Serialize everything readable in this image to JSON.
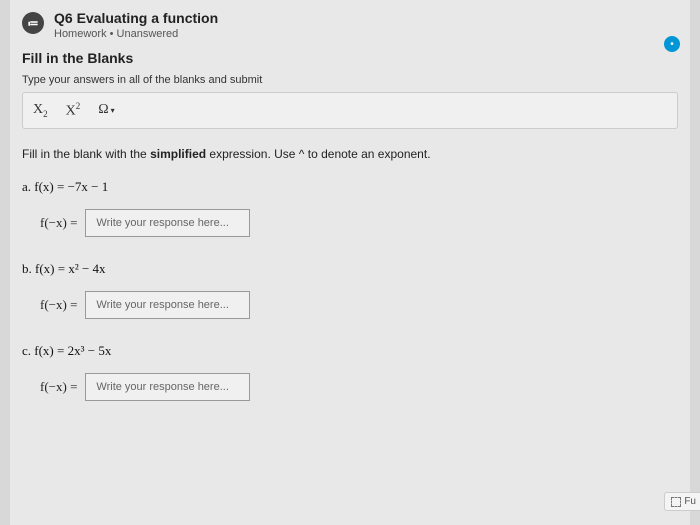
{
  "header": {
    "icon_glyph": "≔",
    "title": "Q6 Evaluating a function",
    "subtitle": "Homework • Unanswered"
  },
  "section": {
    "title": "Fill in the Blanks",
    "subtitle": "Type your answers in all of the blanks and submit"
  },
  "toolbar": {
    "sub_label": "X",
    "sup_label": "X",
    "omega": "Ω",
    "caret": "▾"
  },
  "instruction": {
    "pre": "Fill in the blank with the ",
    "bold": "simplified",
    "post": " expression. Use ^ to denote an exponent."
  },
  "problems": [
    {
      "label": "a. f(x) = −7x − 1",
      "lhs": "f(−x) =",
      "placeholder": "Write your response here..."
    },
    {
      "label": "b. f(x) = x² − 4x",
      "lhs": "f(−x) =",
      "placeholder": "Write your response here..."
    },
    {
      "label": "c. f(x) = 2x³ − 5x",
      "lhs": "f(−x) =",
      "placeholder": "Write your response here..."
    }
  ],
  "badges": {
    "fu": "Fu"
  }
}
